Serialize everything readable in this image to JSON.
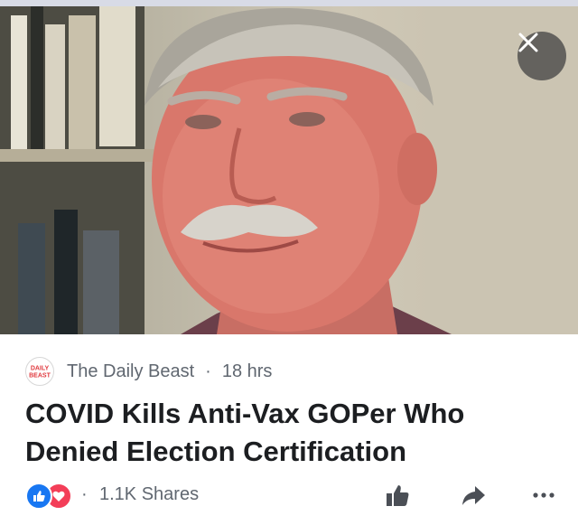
{
  "post": {
    "source": "The Daily Beast",
    "separator": "·",
    "time": "18 hrs",
    "logo_text": [
      "DAILY",
      "BEAST"
    ],
    "headline": "COVID Kills Anti-Vax GOPer Who Denied Election Certification"
  },
  "engagement": {
    "separator": "·",
    "shares": "1.1K Shares",
    "reactions": [
      "like-icon",
      "love-icon"
    ]
  },
  "actions": [
    "thumbs-up-icon",
    "share-arrow-icon",
    "more-options-icon"
  ],
  "icons": {
    "close": "close-icon"
  },
  "colors": {
    "like_blue": "#1877f2",
    "love_red": "#f33e58",
    "secondary_text": "#606770",
    "headline_text": "#1c1e21",
    "action_icon": "#4b4f56"
  }
}
